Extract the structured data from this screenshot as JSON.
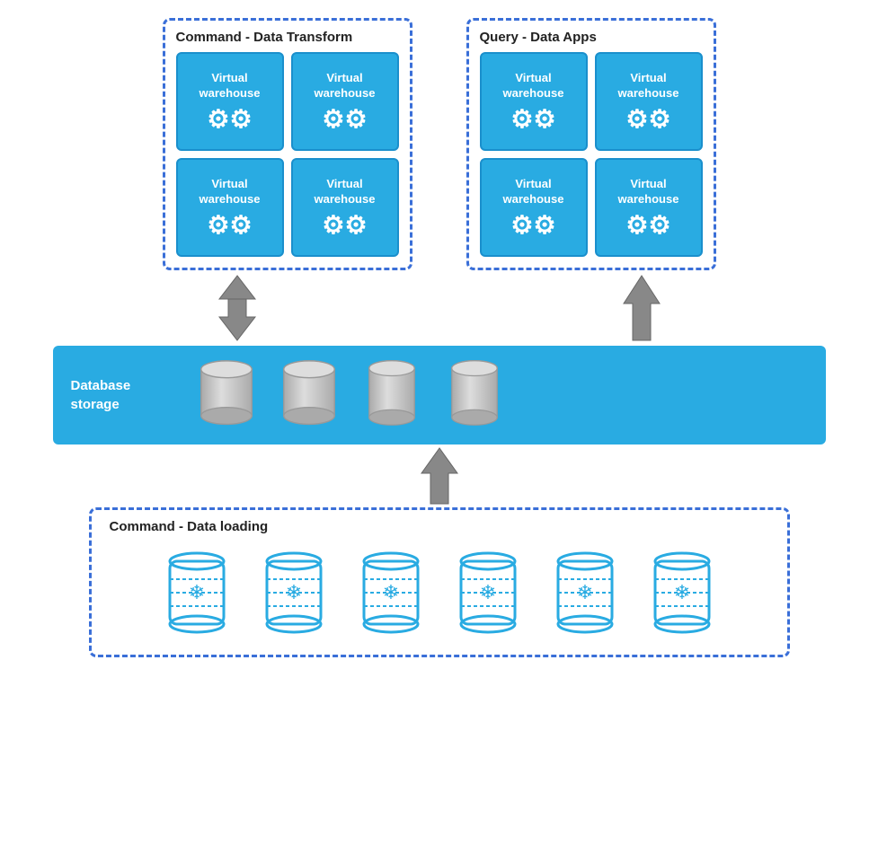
{
  "clusters": {
    "top_left": {
      "title": "Command - Data Transform",
      "tiles": [
        {
          "label": "Virtual\nwarehouse"
        },
        {
          "label": "Virtual\nwarehouse"
        },
        {
          "label": "Virtual\nwarehouse"
        },
        {
          "label": "Virtual\nwarehouse"
        }
      ]
    },
    "top_right": {
      "title": "Query - Data Apps",
      "tiles": [
        {
          "label": "Virtual\nwarehouse"
        },
        {
          "label": "Virtual\nwarehouse"
        },
        {
          "label": "Virtual\nwarehouse"
        },
        {
          "label": "Virtual\nwarehouse"
        }
      ]
    }
  },
  "db_storage": {
    "label": "Database\nstorage",
    "cylinder_count": 4
  },
  "bottom_cluster": {
    "title": "Command - Data loading",
    "loader_count": 6
  },
  "arrows": {
    "left": "double",
    "right": "up",
    "bottom": "up"
  }
}
